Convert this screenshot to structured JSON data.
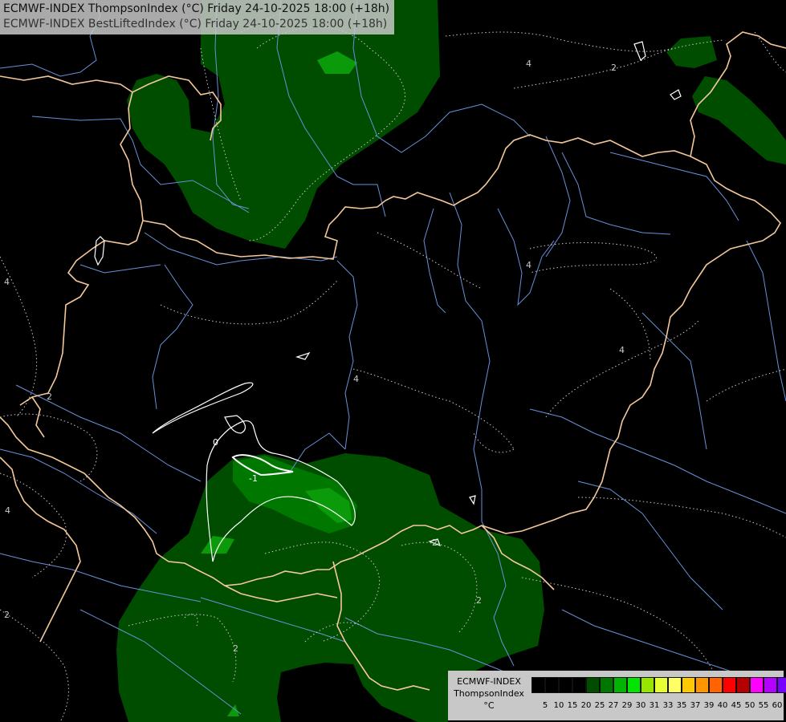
{
  "header": {
    "line1": "ECMWF-INDEX ThompsonIndex (°C) Friday 24-10-2025 18:00 (+18h)",
    "line2": "ECMWF-INDEX BestLiftedIndex (°C) Friday 24-10-2025 18:00 (+18h)"
  },
  "legend": {
    "line1": "ECMWF-INDEX",
    "line2": "ThompsonIndex",
    "line3": "°C",
    "colors": [
      "#000000",
      "#000000",
      "#000000",
      "#000000",
      "#004d00",
      "#007800",
      "#00b400",
      "#00e600",
      "#96e600",
      "#e6ff32",
      "#ffff66",
      "#ffc800",
      "#ff9600",
      "#ff6400",
      "#ff0000",
      "#b40000",
      "#ff00ff",
      "#b400ff",
      "#7800ff",
      "#5000ff",
      "#0000ff"
    ],
    "ticks": [
      "5",
      "10",
      "15",
      "20",
      "25",
      "27",
      "29",
      "30",
      "31",
      "33",
      "35",
      "37",
      "39",
      "40",
      "45",
      "50",
      "55",
      "60"
    ]
  },
  "contour_labels": [
    "4",
    "2",
    "4",
    "4",
    "2",
    "4",
    "2",
    "0",
    "-1",
    "2",
    "2",
    "2",
    "4",
    "2"
  ],
  "colors": {
    "background": "#000000",
    "field_dark_green": "#004d00",
    "field_mid_green": "#0a7d0a",
    "field_light_green": "#00b400",
    "border": "#f5c89a",
    "river": "#6a8fd8",
    "contour": "#c8c8c8",
    "bli_contour": "#ffffff"
  }
}
